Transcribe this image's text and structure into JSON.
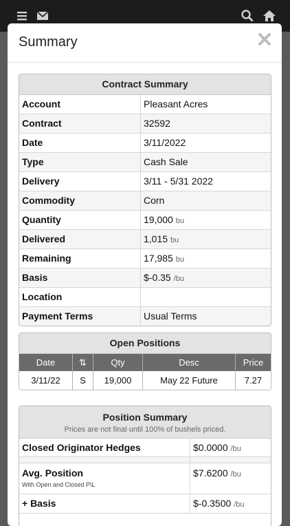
{
  "topbar": {
    "menu_icon": "hamburger-menu-icon",
    "mail_icon": "envelope-icon",
    "search_icon": "search-icon",
    "home_icon": "home-icon"
  },
  "modal": {
    "title": "Summary",
    "close_icon": "close-x-icon"
  },
  "contract_summary": {
    "heading": "Contract Summary",
    "rows": [
      {
        "label": "Account",
        "value": "Pleasant Acres",
        "unit": ""
      },
      {
        "label": "Contract",
        "value": "32592",
        "unit": ""
      },
      {
        "label": "Date",
        "value": "3/11/2022",
        "unit": ""
      },
      {
        "label": "Type",
        "value": "Cash Sale",
        "unit": ""
      },
      {
        "label": "Delivery",
        "value": "3/11 - 5/31 2022",
        "unit": ""
      },
      {
        "label": "Commodity",
        "value": "Corn",
        "unit": ""
      },
      {
        "label": "Quantity",
        "value": "19,000",
        "unit": "bu"
      },
      {
        "label": "Delivered",
        "value": "1,015",
        "unit": "bu"
      },
      {
        "label": "Remaining",
        "value": "17,985",
        "unit": "bu"
      },
      {
        "label": "Basis",
        "value": "$-0.35",
        "unit": "/bu"
      },
      {
        "label": "Location",
        "value": "",
        "unit": ""
      },
      {
        "label": "Payment Terms",
        "value": "Usual Terms",
        "unit": ""
      }
    ]
  },
  "open_positions": {
    "heading": "Open Positions",
    "columns": {
      "date": "Date",
      "sort": "⇅",
      "qty": "Qty",
      "desc": "Desc",
      "price": "Price"
    },
    "row": {
      "date": "3/11/22",
      "side": "S",
      "qty": "19,000",
      "desc": "May 22 Future",
      "price": "7.27"
    }
  },
  "position_summary": {
    "heading": "Position Summary",
    "subtitle": "Prices are not final until 100% of bushels priced.",
    "rows": [
      {
        "label": "Closed Originator Hedges",
        "note": "",
        "value": "$0.0000",
        "unit": "/bu"
      },
      {
        "label": "Avg. Position",
        "note": "With Open and Closed P\\L",
        "value": "$7.6200",
        "unit": "/bu"
      },
      {
        "label": "+ Basis",
        "note": "",
        "value": "$-0.3500",
        "unit": "/bu"
      }
    ]
  }
}
